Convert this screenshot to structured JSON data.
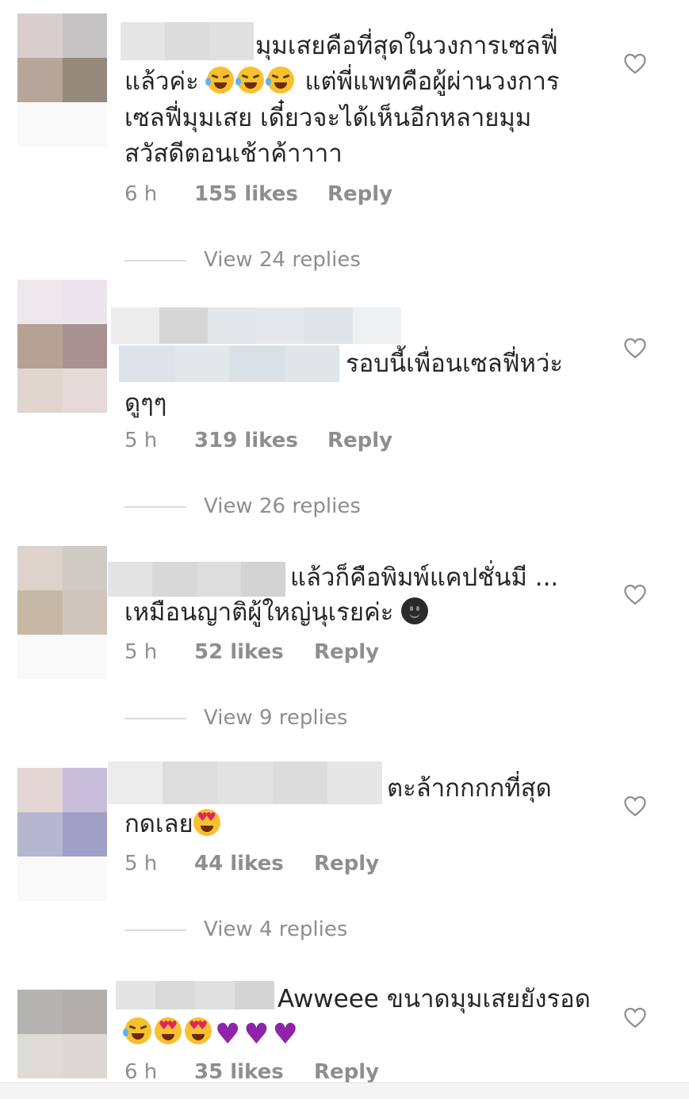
{
  "comments": [
    {
      "text_lines": [
        "มุมเสยคือที่สุดในวงการเซลฟี่",
        "แล้วค่ะ",
        "แต่พี่แพทคือผู้ผ่านวงการ",
        "เซลฟี่มุมเสย เดี๋ยวจะได้เห็นอีกหลายมุม",
        "สวัสดีตอนเช้าค้าาาา"
      ],
      "time": "6 h",
      "likes": "155 likes",
      "reply": "Reply",
      "view_replies": "View 24 replies",
      "avatar_colors": [
        "#d8cfcd",
        "#c5c3c4",
        "#b6a69a",
        "#958a7c",
        "#f9f9f9",
        "#f9f9f9"
      ],
      "emojis": [
        "rolling-on-floor-laughing",
        "rolling-on-floor-laughing",
        "rolling-on-floor-laughing"
      ]
    },
    {
      "text_lines": [
        "รอบนี้เพื่อนเซลฟี่หว่ะ",
        "ดูๆๆ"
      ],
      "time": "5 h",
      "likes": "319 likes",
      "reply": "Reply",
      "view_replies": "View 26 replies",
      "avatar_colors": [
        "#eee8ec",
        "#ece5eb",
        "#b5a294",
        "#a89291",
        "#e1d5cf",
        "#e4dad7"
      ]
    },
    {
      "text_lines": [
        "แล้วก็คือพิมพ์แคปชั่นมี ...",
        "เหมือนญาติผู้ใหญ่นุเรยค่ะ"
      ],
      "time": "5 h",
      "likes": "52 likes",
      "reply": "Reply",
      "view_replies": "View 9 replies",
      "avatar_colors": [
        "#dcd3cd",
        "#cfcac4",
        "#c7b7a6",
        "#cfc5bd",
        "#f9f9f9",
        "#f9f9f9"
      ],
      "emojis": [
        "dark-smiley"
      ]
    },
    {
      "text_lines": [
        "ตะล้ากกกกที่สุด",
        "กดเลย"
      ],
      "time": "5 h",
      "likes": "44 likes",
      "reply": "Reply",
      "view_replies": "View 4 replies",
      "avatar_colors": [
        "#e3d6d4",
        "#c9bed9",
        "#b5b7d0",
        "#a19fc7",
        "#f9f9f9",
        "#f9f9f9"
      ],
      "emojis": [
        "heart-eyes"
      ]
    },
    {
      "text_lines": [
        "Awweee ขนาดมุมเสยยังรอด"
      ],
      "time": "6 h",
      "likes": "35 likes",
      "reply": "Reply",
      "avatar_colors": [
        "#b5b3b1",
        "#b2aeab",
        "#dedbd7",
        "#dcd8d4",
        "#f9f9f9",
        "#f9f9f9"
      ],
      "emojis": [
        "tears-of-joy",
        "heart-eyes",
        "heart-eyes",
        "purple-heart",
        "purple-heart",
        "purple-heart"
      ]
    }
  ],
  "icons": {
    "like": "heart-outline-icon"
  },
  "colors": {
    "text": "#262626",
    "meta": "#8e8e8e",
    "divider": "#dbdbdb"
  }
}
